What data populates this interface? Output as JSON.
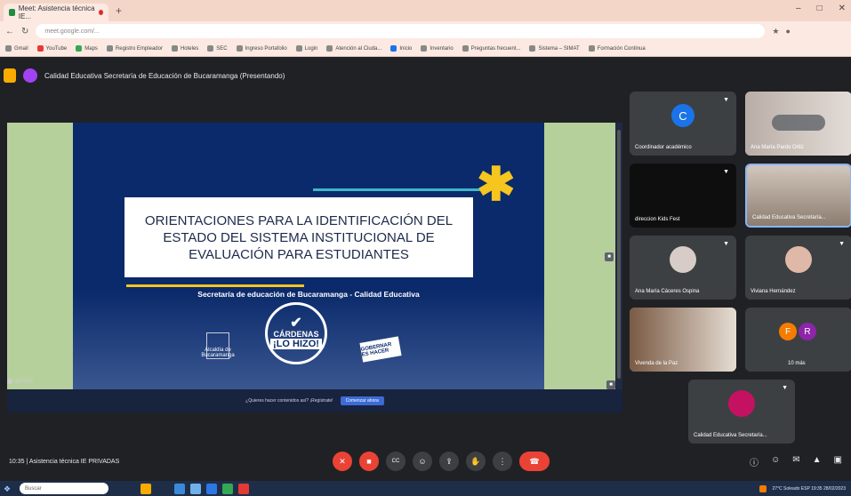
{
  "browser": {
    "tab_title": "Meet: Asistencia técnica IE...",
    "new_tab": "+",
    "win_controls": [
      "–",
      "□",
      "✕"
    ],
    "url": "meet.google.com/...",
    "bookmarks": [
      "Gmail",
      "YouTube",
      "Maps",
      "Registro Empleador",
      "Hoteles",
      "SEC",
      "Ingreso Portafolio",
      "Login",
      "Atención al Ciuda...",
      "Inicio",
      "Inventario",
      "Preguntas frecuent...",
      "Sistema – SIMAT",
      "Formación Continua"
    ]
  },
  "meeting": {
    "title": "Calidad Educativa Secretaría de Educación de Bucaramanga (Presentando)",
    "bottom_id": "10:35  |  Asistencia técnica IE PRIVADAS"
  },
  "slide": {
    "title": "ORIENTACIONES PARA LA IDENTIFICACIÓN DEL ESTADO DEL SISTEMA INSTITUCIONAL DE EVALUACIÓN PARA ESTUDIANTES",
    "subtitle": "Secretaría de educación de Bucaramanga - Calidad Educativa",
    "badge_top": "CÁRDENAS",
    "badge_bottom": "¡LO HIZO!",
    "logo_left": "Alcaldía de Bucaramanga",
    "logo_right": "GOBERNAR ES HACER",
    "footnote": "¿Quieres hacer contenidos así? ¡Regístrate!",
    "footbtn": "Comenzar ahora",
    "presenter": "genially"
  },
  "participants": [
    {
      "name": "Coordinador académico",
      "initial": "C",
      "color": "#1a73e8"
    },
    {
      "name": "Ana María Pardo Ortiz",
      "initial": "",
      "color": ""
    },
    {
      "name": "direccion Kids Fest",
      "initial": "",
      "color": ""
    },
    {
      "name": "Calidad Educativa Secretaría...",
      "initial": "",
      "color": ""
    },
    {
      "name": "Ana María Cáceres Ospina",
      "initial": "",
      "color": ""
    },
    {
      "name": "Viviana Hernández",
      "initial": "",
      "color": ""
    },
    {
      "name": "Vivenda de la Paz",
      "initial": "",
      "color": ""
    },
    {
      "name": "10 más",
      "initial": "F",
      "initial2": "R",
      "color": "#f57c00",
      "color2": "#8e24aa"
    },
    {
      "name": "Calidad Educativa Secretaría...",
      "initial": "",
      "color": ""
    }
  ],
  "controls": {
    "mic": "✕",
    "cam": "■",
    "cc": "CC",
    "emoji": "☺",
    "present": "⇪",
    "hand": "✋",
    "more": "⋮",
    "end": "☎",
    "right": [
      "ⓘ",
      "☺",
      "✉",
      "▲",
      "▣"
    ]
  },
  "taskbar": {
    "search": "Buscar",
    "tray": "27°C Soleado   ESP   19:35   28/02/2023"
  }
}
